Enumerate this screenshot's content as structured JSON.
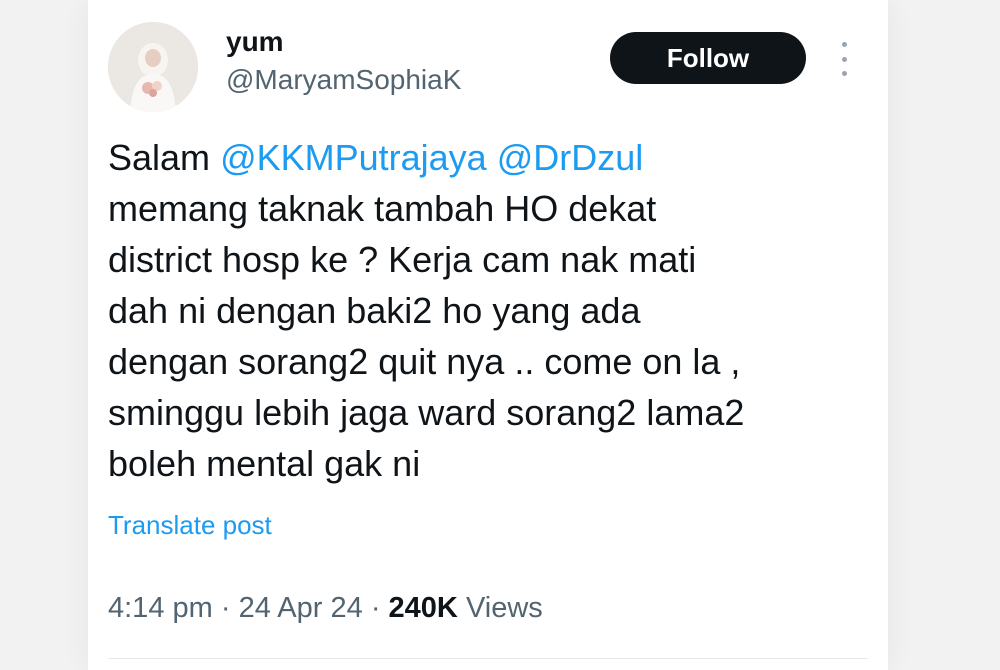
{
  "author": {
    "display_name": "yum",
    "handle": "@MaryamSophiaK"
  },
  "follow_label": "Follow",
  "tweet": {
    "greeting": "Salam",
    "mentions": [
      "@KKMPutrajaya",
      "@DrDzul"
    ],
    "lines": [
      "memang taknak tambah HO dekat",
      "district hosp ke ? Kerja cam nak mati",
      "dah ni dengan baki2 ho yang ada",
      "dengan sorang2 quit nya .. come on la ,",
      "sminggu lebih jaga ward sorang2 lama2",
      "boleh mental gak ni"
    ]
  },
  "translate_label": "Translate post",
  "meta": {
    "time": "4:14 pm",
    "separator": "·",
    "date": "24 Apr 24",
    "views_count": "240K",
    "views_label": "Views"
  },
  "colors": {
    "text": "#0f1419",
    "secondary": "#536471",
    "link": "#1d9bf0",
    "button": "#0f1419"
  },
  "icons": [
    "more-options-icon"
  ]
}
